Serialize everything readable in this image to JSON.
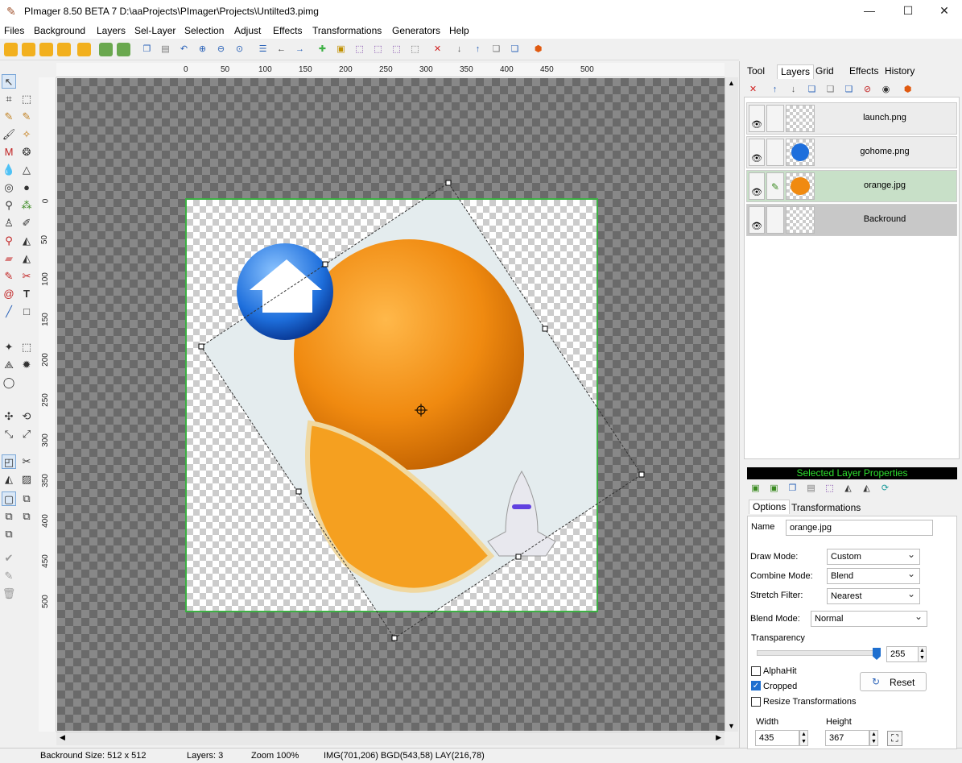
{
  "window": {
    "title": "PImager 8.50 BETA 7   D:\\aaProjects\\PImager\\Projects\\Untilted3.pimg",
    "minimize": "—",
    "maximize": "☐",
    "close": "✕"
  },
  "menu": [
    "Files",
    "Background",
    "Layers",
    "Sel-Layer",
    "Selection",
    "Adjust",
    "Effects",
    "Transformations",
    "Generators",
    "Help"
  ],
  "rulers": {
    "h": [
      "0",
      "50",
      "100",
      "150",
      "200",
      "250",
      "300",
      "350",
      "400",
      "450",
      "500"
    ],
    "v": [
      "0",
      "50",
      "100",
      "150",
      "200",
      "250",
      "300",
      "350",
      "400",
      "450",
      "500"
    ]
  },
  "panel": {
    "tabs": [
      "Tool",
      "Layers",
      "Grid",
      "Effects",
      "History"
    ],
    "active_tab": "Layers"
  },
  "layers": [
    {
      "name": "launch.png",
      "state": "normal"
    },
    {
      "name": "gohome.png",
      "state": "normal"
    },
    {
      "name": "orange.jpg",
      "state": "selected"
    },
    {
      "name": "Backround",
      "state": "background"
    }
  ],
  "props": {
    "header": "Selected Layer Properties",
    "tabs": [
      "Options",
      "Transformations"
    ],
    "name_label": "Name",
    "name_value": "orange.jpg",
    "draw_mode_label": "Draw Mode:",
    "draw_mode": "Custom",
    "combine_mode_label": "Combine Mode:",
    "combine_mode": "Blend",
    "stretch_filter_label": "Stretch Filter:",
    "stretch_filter": "Nearest",
    "blend_mode_label": "Blend Mode:",
    "blend_mode": "Normal",
    "transparency_label": "Transparency",
    "transparency_value": "255",
    "transparency_fraction": 1.0,
    "alphahit_label": "AlphaHit",
    "cropped_label": "Cropped",
    "resize_label": "Resize Transformations",
    "reset_label": "Reset",
    "width_label": "Width",
    "width_value": "435",
    "height_label": "Height",
    "height_value": "367"
  },
  "status": {
    "size": "Backround Size: 512 x 512",
    "layers": "Layers: 3",
    "zoom": "Zoom 100%",
    "coords": "IMG(701,206)  BGD(543,58)  LAY(216,78)"
  },
  "colors": {
    "selection_border": "#3cb043",
    "selected_layer": "#c8e0c8",
    "header_text": "#2ee02e"
  }
}
